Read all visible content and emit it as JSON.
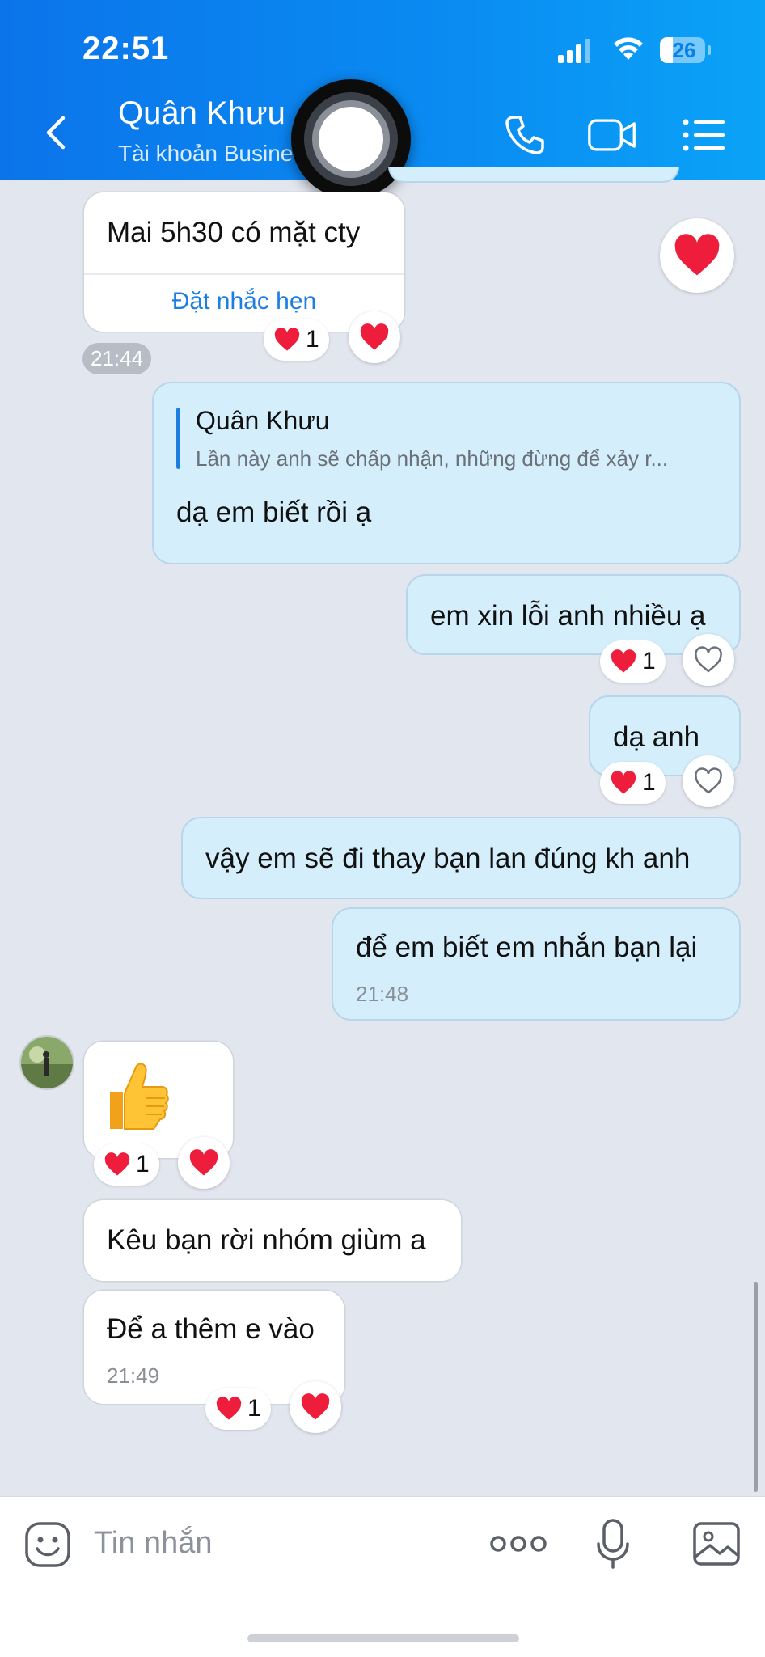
{
  "status_bar": {
    "time": "22:51",
    "battery": "26"
  },
  "header": {
    "contact_name": "Quân Khưu",
    "contact_subtitle": "Tài khoản Busine",
    "colors": {
      "accent": "#0a8cf2"
    }
  },
  "messages": {
    "m1": {
      "text": "Mai 5h30 có mặt cty",
      "action": "Đặt nhắc hẹn",
      "react_count": "1",
      "time": "21:44"
    },
    "m2": {
      "quote_author": "Quân Khưu",
      "quote_text": "Lần này anh sẽ chấp nhận, những đừng để xảy r...",
      "text": "dạ em biết rồi ạ"
    },
    "m3": {
      "text": "em xin lỗi anh nhiều ạ",
      "react_count": "1"
    },
    "m4": {
      "text": "dạ anh",
      "react_count": "1"
    },
    "m5": {
      "text": "vậy em sẽ đi thay bạn lan đúng kh anh"
    },
    "m6": {
      "text": "để em biết em nhắn bạn lại",
      "time": "21:48"
    },
    "m7": {
      "sticker": "thumbs-up",
      "react_count": "1"
    },
    "m8": {
      "text": "Kêu bạn rời nhóm giùm a"
    },
    "m9": {
      "text": "Để a thêm e vào",
      "time": "21:49",
      "react_count": "1"
    }
  },
  "composer": {
    "placeholder": "Tin nhắn"
  }
}
